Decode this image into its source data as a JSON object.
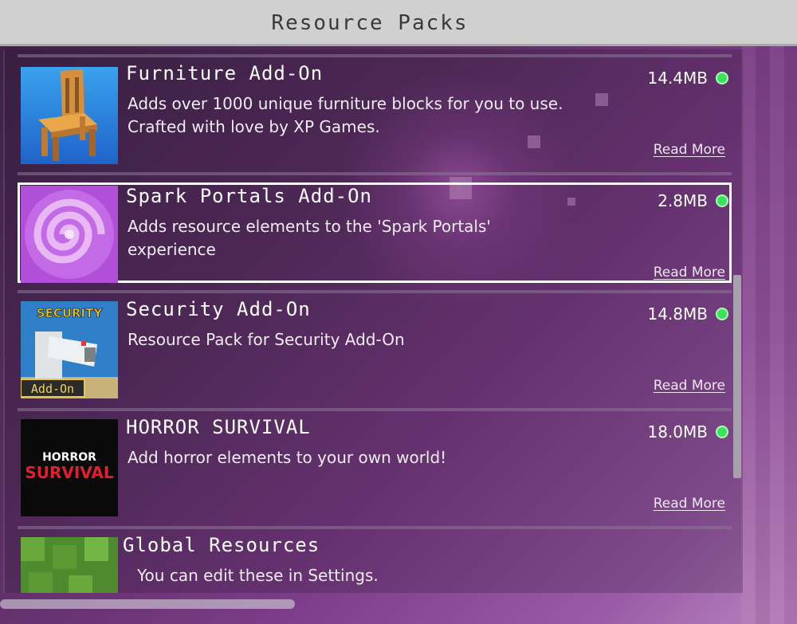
{
  "header": {
    "title": "Resource Packs"
  },
  "packs": [
    {
      "name": "Furniture Add-On",
      "description": "Adds over 1000 unique furniture blocks for you to use. Crafted with love by XP Games.",
      "size": "14.4MB",
      "read_more": "Read More",
      "status_color": "#39e35a"
    },
    {
      "name": "Spark Portals Add-On",
      "description": "Adds resource elements to the 'Spark Portals' experience",
      "size": "2.8MB",
      "read_more": "Read More",
      "status_color": "#39e35a"
    },
    {
      "name": "Security Add-On",
      "description": "Resource Pack for Security Add-On",
      "size": "14.8MB",
      "read_more": "Read More",
      "status_color": "#39e35a",
      "thumb_title": "SECURITY",
      "thumb_badge": "Add-On"
    },
    {
      "name": "HORROR SURVIVAL",
      "description": "Add horror elements to your own world!",
      "size": "18.0MB",
      "read_more": "Read More",
      "status_color": "#39e35a",
      "thumb_line1": "HORROR",
      "thumb_line2": "SURVIVAL"
    }
  ],
  "global": {
    "name": "Global Resources",
    "description": "You can edit these in Settings."
  }
}
